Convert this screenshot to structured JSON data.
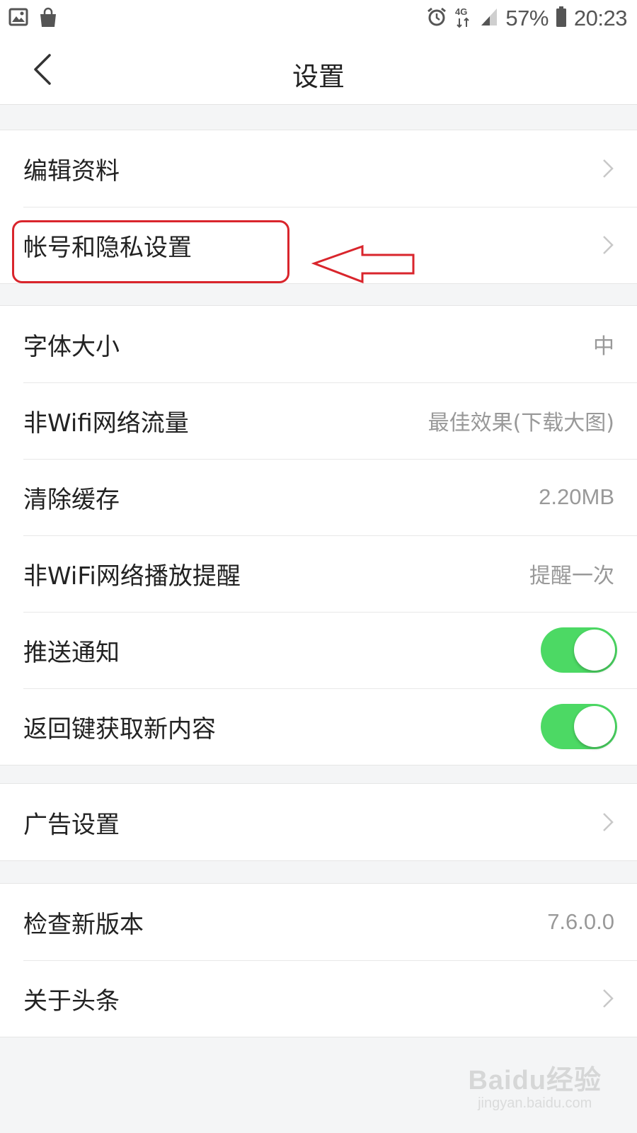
{
  "status_bar": {
    "battery": "57%",
    "time": "20:23",
    "network": "4G",
    "left_icons": [
      "gallery-icon",
      "shopping-bag-icon"
    ],
    "right_icons": [
      "alarm-icon",
      "network-4g-icon",
      "signal-icon",
      "battery-icon"
    ]
  },
  "nav": {
    "title": "设置",
    "back_icon": "chevron-left-icon"
  },
  "groups": [
    {
      "rows": [
        {
          "label": "编辑资料",
          "chevron": true
        },
        {
          "label": "帐号和隐私设置",
          "chevron": true
        }
      ]
    },
    {
      "rows": [
        {
          "label": "字体大小",
          "value": "中"
        },
        {
          "label": "非Wifi网络流量",
          "value": "最佳效果(下载大图)"
        },
        {
          "label": "清除缓存",
          "value": "2.20MB"
        },
        {
          "label": "非WiFi网络播放提醒",
          "value": "提醒一次"
        },
        {
          "label": "推送通知",
          "toggle": true,
          "toggle_on": true
        },
        {
          "label": "返回键获取新内容",
          "toggle": true,
          "toggle_on": true
        }
      ]
    },
    {
      "rows": [
        {
          "label": "广告设置",
          "chevron": true
        }
      ]
    },
    {
      "rows": [
        {
          "label": "检查新版本",
          "value": "7.6.0.0"
        },
        {
          "label": "关于头条",
          "chevron": true
        }
      ]
    }
  ],
  "annotation": {
    "highlight_color": "#d9252c",
    "target": "帐号和隐私设置"
  },
  "colors": {
    "toggle_on": "#4cd964",
    "value_text": "#999999",
    "background": "#f4f5f6"
  },
  "watermark": {
    "logo": "Baidu经验",
    "sub": "jingyan.baidu.com"
  }
}
